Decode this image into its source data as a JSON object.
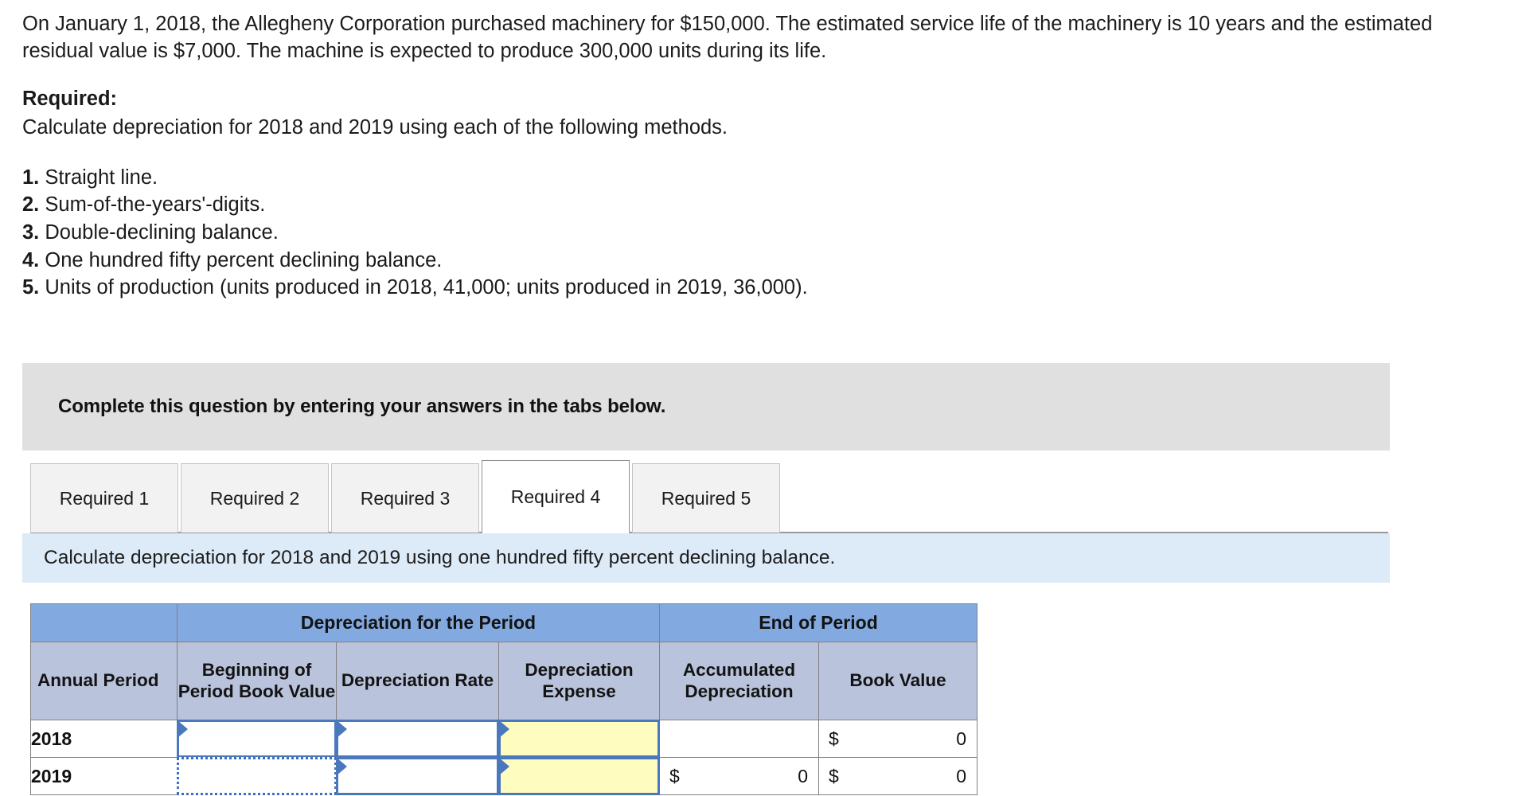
{
  "problem": {
    "paragraph": "On January 1, 2018, the Allegheny Corporation purchased machinery for $150,000. The estimated service life of the machinery is 10 years and the estimated residual value is $7,000. The machine is expected to produce 300,000 units during its life."
  },
  "required": {
    "heading": "Required:",
    "instruction": "Calculate depreciation for 2018 and 2019 using each of the following methods."
  },
  "methods": [
    {
      "number": "1.",
      "text": "Straight line."
    },
    {
      "number": "2.",
      "text": "Sum-of-the-years'-digits."
    },
    {
      "number": "3.",
      "text": "Double-declining balance."
    },
    {
      "number": "4.",
      "text": "One hundred fifty percent declining balance."
    },
    {
      "number": "5.",
      "text": "Units of production (units produced in 2018, 41,000; units produced in 2019, 36,000)."
    }
  ],
  "banner": {
    "text": "Complete this question by entering your answers in the tabs below."
  },
  "tabs": [
    {
      "label": "Required 1",
      "active": false
    },
    {
      "label": "Required 2",
      "active": false
    },
    {
      "label": "Required 3",
      "active": false
    },
    {
      "label": "Required 4",
      "active": true
    },
    {
      "label": "Required 5",
      "active": false
    }
  ],
  "instruction_bar": {
    "text": "Calculate depreciation for 2018 and 2019 using one hundred fifty percent declining balance."
  },
  "table": {
    "group_headers": [
      {
        "label": "",
        "span": 1
      },
      {
        "label": "Depreciation for the Period",
        "span": 3
      },
      {
        "label": "End of Period",
        "span": 2
      }
    ],
    "columns": [
      "Annual Period",
      "Beginning of Period Book Value",
      "Depreciation Rate",
      "Depreciation Expense",
      "Accumulated Depreciation",
      "Book Value"
    ],
    "rows": [
      {
        "period": "2018",
        "beginning_book_value": "",
        "depreciation_rate": "",
        "depreciation_expense": "",
        "accumulated_depreciation": "",
        "book_value_symbol": "$",
        "book_value": "0",
        "accumulated_symbol": "",
        "accumulated_value": ""
      },
      {
        "period": "2019",
        "beginning_book_value": "",
        "depreciation_rate": "",
        "depreciation_expense": "",
        "accumulated_symbol": "$",
        "accumulated_value": "0",
        "book_value_symbol": "$",
        "book_value": "0"
      }
    ]
  },
  "colors": {
    "header_blue": "#82a9e0",
    "subheader_blue": "#b9c3db",
    "instruction_blue": "#ddeaf7",
    "banner_gray": "#e0e0e0",
    "input_border_blue": "#4a78bd",
    "input_yellow": "#fffcc0",
    "active_tab_white": "#ffffff",
    "tab_gray": "#f2f2f2"
  }
}
